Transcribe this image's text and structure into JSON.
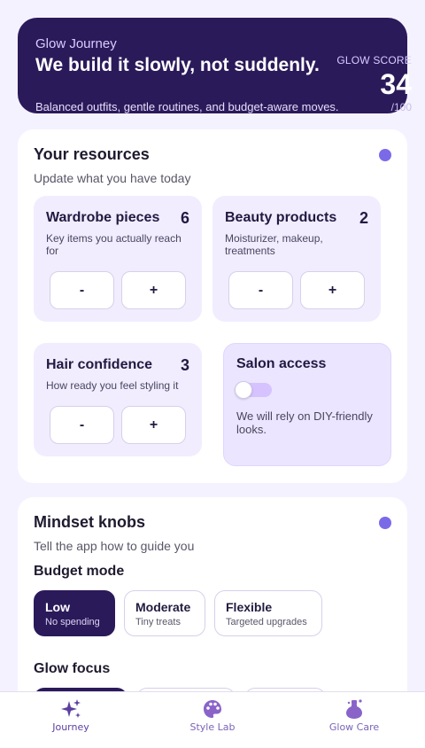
{
  "hero": {
    "kicker": "Glow Journey",
    "headline": "We build it slowly, not suddenly.",
    "subtitle": "Balanced outfits, gentle routines, and budget-aware moves.",
    "score_label": "GLOW SCORE",
    "score_value": "34",
    "score_max": "/100"
  },
  "resources": {
    "title": "Your resources",
    "subtitle": "Update what you have today",
    "tiles": [
      {
        "title": "Wardrobe pieces",
        "count": "6",
        "desc": "Key items you actually reach for",
        "minus": "-",
        "plus": "+"
      },
      {
        "title": "Beauty products",
        "count": "2",
        "desc": "Moisturizer, makeup, treatments",
        "minus": "-",
        "plus": "+"
      },
      {
        "title": "Hair confidence",
        "count": "3",
        "desc": "How ready you feel styling it",
        "minus": "-",
        "plus": "+"
      }
    ],
    "salon": {
      "title": "Salon access",
      "enabled": false,
      "desc": "We will rely on DIY-friendly looks."
    }
  },
  "mindset": {
    "title": "Mindset knobs",
    "subtitle": "Tell the app how to guide you",
    "budget_label": "Budget mode",
    "budget_options": [
      {
        "title": "Low",
        "sub": "No spending",
        "selected": true
      },
      {
        "title": "Moderate",
        "sub": "Tiny treats",
        "selected": false
      },
      {
        "title": "Flexible",
        "sub": "Targeted upgrades",
        "selected": false
      }
    ],
    "focus_label": "Glow focus"
  },
  "nav": {
    "items": [
      {
        "label": "Journey",
        "icon": "sparkles-icon",
        "active": true
      },
      {
        "label": "Style Lab",
        "icon": "palette-icon",
        "active": false
      },
      {
        "label": "Glow Care",
        "icon": "potion-icon",
        "active": false
      }
    ]
  },
  "colors": {
    "background": "#f5f2ff",
    "hero": "#2b1a5a",
    "accent": "#7b6ae8",
    "tile": "#f1edff"
  }
}
